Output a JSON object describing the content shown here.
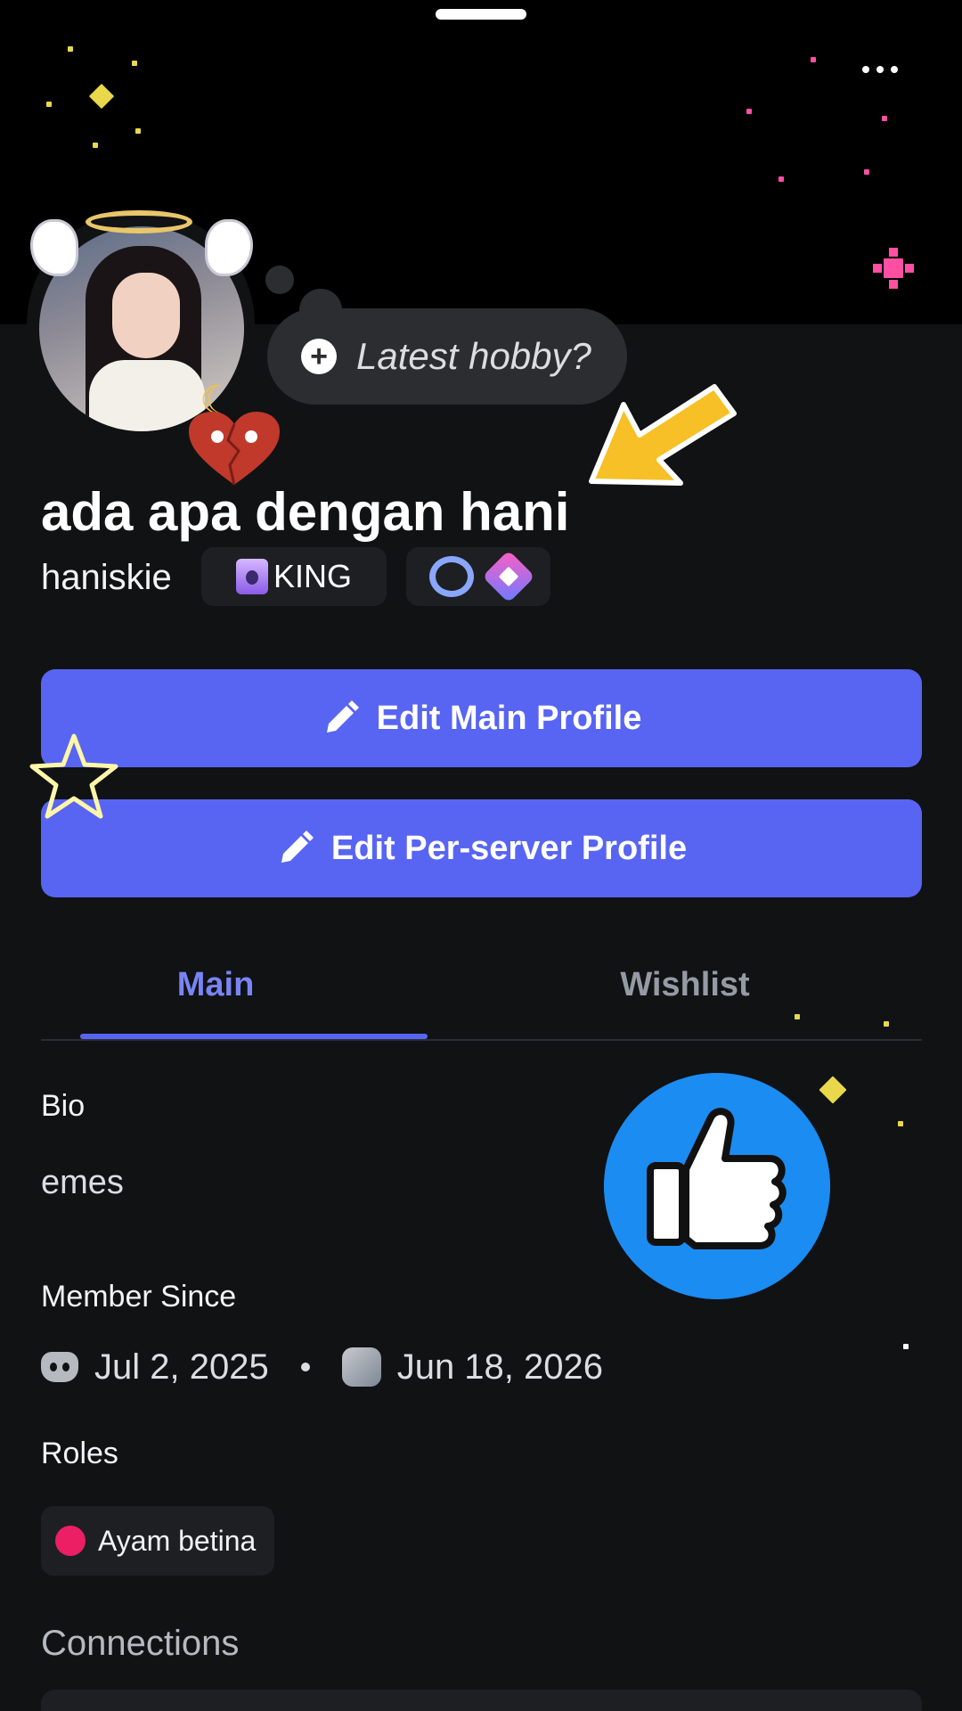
{
  "header": {
    "grabber": "sheet-handle",
    "more_icon": "more-horizontal-icon"
  },
  "profile": {
    "hobby_prompt": "Latest hobby?",
    "display_name": "ada apa dengan hani",
    "username": "haniskie",
    "clan_tag": "KING"
  },
  "actions": {
    "edit_main": "Edit Main Profile",
    "edit_server": "Edit Per-server Profile"
  },
  "tabs": {
    "main": "Main",
    "wishlist": "Wishlist",
    "active": "Main"
  },
  "bio": {
    "label": "Bio",
    "text": "emes"
  },
  "member_since": {
    "label": "Member Since",
    "discord_date": "Jul 2, 2025",
    "server_date": "Jun 18, 2026"
  },
  "roles": {
    "label": "Roles",
    "items": [
      {
        "name": "Ayam betina",
        "color": "#ec1f64"
      }
    ]
  },
  "connections": {
    "label": "Connections"
  },
  "colors": {
    "accent": "#5865f2",
    "tab_active": "#7984f5",
    "background": "#111214",
    "banner": "#000000"
  }
}
